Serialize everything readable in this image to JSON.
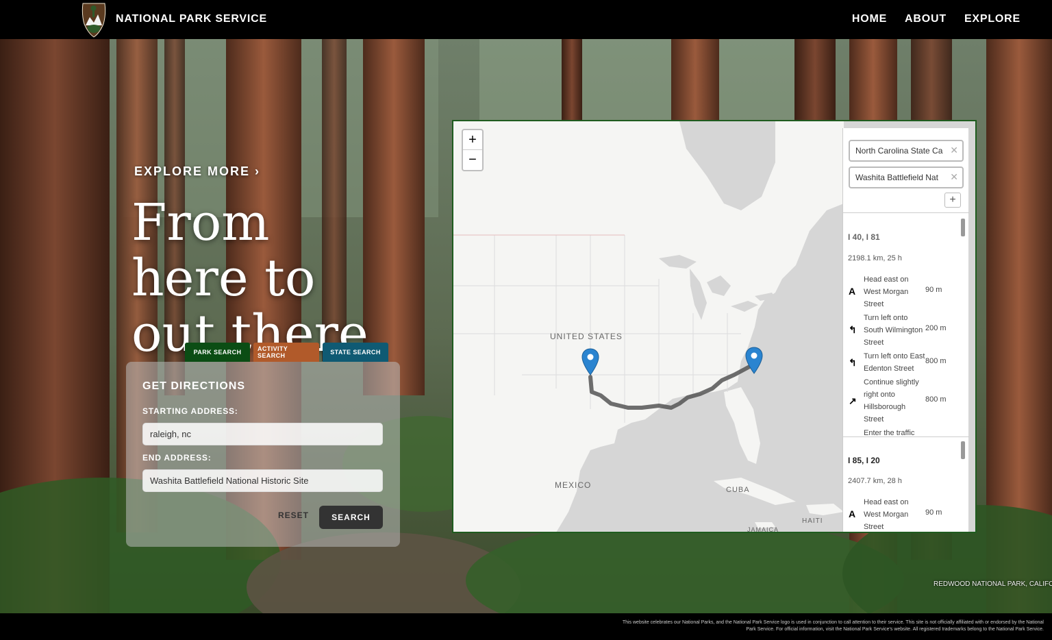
{
  "header": {
    "brand": "NATIONAL PARK SERVICE",
    "nav": [
      "HOME",
      "ABOUT",
      "EXPLORE"
    ]
  },
  "hero": {
    "explore_more": "EXPLORE MORE ›",
    "tagline_lines": [
      "From",
      "here to",
      "out there."
    ],
    "photo_credit": "REDWOOD NATIONAL PARK, CALIFORNIA"
  },
  "tabs": [
    "PARK SEARCH",
    "ACTIVITY SEARCH",
    "STATE SEARCH"
  ],
  "directions": {
    "title": "GET DIRECTIONS",
    "start_label": "STARTING ADDRESS:",
    "start_value": "raleigh, nc",
    "end_label": "END ADDRESS:",
    "end_value": "Washita Battlefield National Historic Site",
    "reset_label": "RESET",
    "search_label": "SEARCH"
  },
  "map": {
    "zoom_in": "+",
    "zoom_out": "−",
    "labels": {
      "usa": "UNITED STATES",
      "mexico": "MEXICO",
      "cuba": "CUBA",
      "haiti": "HAITI",
      "jamaica": "JAMAICA"
    },
    "waypoints": [
      "North Carolina State Ca",
      "Washita Battlefield Nat"
    ],
    "add_waypoint": "+",
    "routes": [
      {
        "name": "I 40, I 81",
        "summary": "2198.1 km, 25 h",
        "steps": [
          {
            "icon": "A",
            "text": "Head east on West Morgan Street",
            "dist": "90 m"
          },
          {
            "icon": "↰",
            "text": "Turn left onto South Wilmington Street",
            "dist": "200 m"
          },
          {
            "icon": "↰",
            "text": "Turn left onto East Edenton Street",
            "dist": "800 m"
          },
          {
            "icon": "↗",
            "text": "Continue slightly right onto Hillsborough Street",
            "dist": "800 m"
          },
          {
            "icon": "",
            "text": "Enter the traffic",
            "dist": ""
          }
        ]
      },
      {
        "name": "I 85, I 20",
        "summary": "2407.7 km, 28 h",
        "steps": [
          {
            "icon": "A",
            "text": "Head east on West Morgan Street",
            "dist": "90 m"
          }
        ]
      }
    ]
  },
  "footer": {
    "disclaimer": "This website celebrates our National Parks, and the National Park Service logo is used in conjunction to call attention to their service. This site is not officially affiliated with or endorsed by the National Park Service. For official information, visit the National Park Service's website. All registered trademarks belong to the National Park Service."
  }
}
